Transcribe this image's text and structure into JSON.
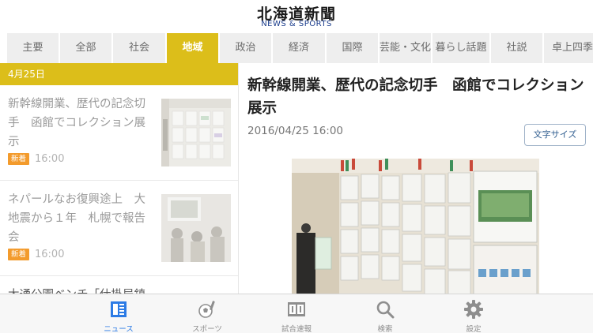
{
  "header": {
    "logo": "北海道新聞",
    "subtitle": "NEWS & SPORTS"
  },
  "tabs": [
    {
      "label": "主要"
    },
    {
      "label": "全部"
    },
    {
      "label": "社会"
    },
    {
      "label": "地域",
      "active": true
    },
    {
      "label": "政治"
    },
    {
      "label": "経済"
    },
    {
      "label": "国際"
    },
    {
      "label": "芸能・文化"
    },
    {
      "label": "暮らし話題"
    },
    {
      "label": "社説"
    },
    {
      "label": "卓上四季"
    }
  ],
  "list": {
    "date": "4月25日",
    "items": [
      {
        "title": "新幹線開業、歴代の記念切手　函館でコレクション展示",
        "badge": "新着",
        "time": "16:00"
      },
      {
        "title": "ネパールなお復興途上　大地震から１年　札幌で報告会",
        "badge": "新着",
        "time": "16:00"
      },
      {
        "title": "大通公園ベンチ「仕掛局鎮"
      }
    ]
  },
  "article": {
    "title": "新幹線開業、歴代の記念切手　函館でコレクション展示",
    "date": "2016/04/25 16:00",
    "font_size_button": "文字サイズ"
  },
  "bottom_tabs": [
    {
      "label": "ニュース",
      "icon": "newspaper-icon",
      "active": true
    },
    {
      "label": "スポーツ",
      "icon": "soccer-ball-icon"
    },
    {
      "label": "試合速報",
      "icon": "scoreboard-icon"
    },
    {
      "label": "検索",
      "icon": "search-icon"
    },
    {
      "label": "設定",
      "icon": "gear-icon"
    }
  ],
  "colors": {
    "accent": "#dcbe1a",
    "badge": "#f39b2c",
    "tab_active_blue": "#2c7be5"
  }
}
